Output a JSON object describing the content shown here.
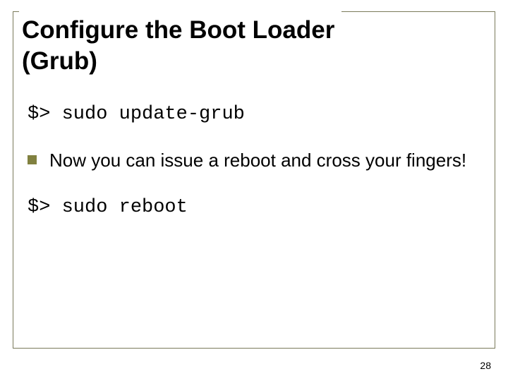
{
  "slide": {
    "title_line1": "Configure the Boot Loader",
    "title_line2": "(Grub)",
    "command1": "$> sudo update-grub",
    "bullet1": "Now you can issue a reboot and cross your fingers!",
    "command2": "$> sudo reboot",
    "page_number": "28"
  }
}
